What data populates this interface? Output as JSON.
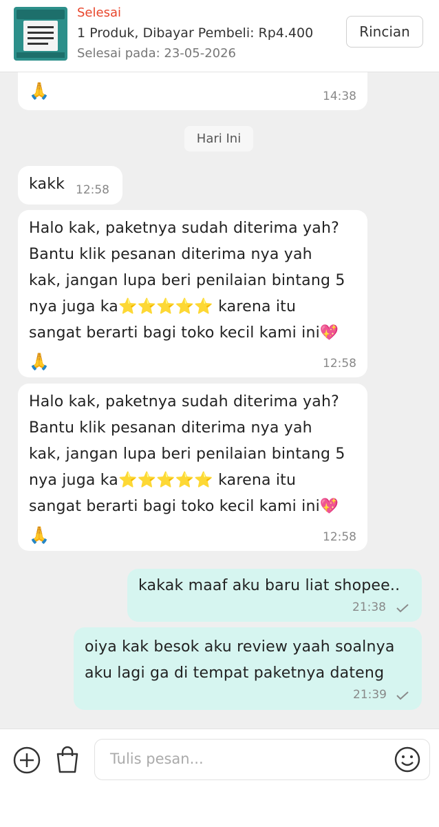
{
  "order": {
    "status": "Selesai",
    "summary": "1 Produk, Dibayar Pembeli: Rp4.400",
    "completed_at": "Selesai pada: 23-05-2026",
    "detail_button": "Rincian"
  },
  "messages": [
    {
      "from": "seller",
      "text": "🙏",
      "time": "14:38"
    },
    {
      "from": "seller",
      "text": "kakk",
      "time": "12:58"
    },
    {
      "from": "seller",
      "text": "Halo kak, paketnya sudah diterima yah?\nBantu klik pesanan diterima nya yah\nkak, jangan lupa beri penilaian bintang 5\nnya juga ka⭐⭐⭐⭐⭐ karena itu\nsangat berarti bagi toko kecil kami ini💖",
      "time": "12:58"
    },
    {
      "from": "seller",
      "text": "Halo kak, paketnya sudah diterima yah?\nBantu klik pesanan diterima nya yah\nkak, jangan lupa beri penilaian bintang 5\nnya juga ka⭐⭐⭐⭐⭐ karena itu\nsangat berarti bagi toko kecil kami ini💖",
      "time": "12:58"
    },
    {
      "from": "buyer",
      "text": "kakak maaf aku baru liat shopee..",
      "time": "21:38"
    },
    {
      "from": "buyer",
      "text": "oiya kak besok aku review yaah soalnya\naku lagi ga di tempat paketnya dateng",
      "time": "21:39"
    }
  ],
  "day_separator": "Hari Ini",
  "composer": {
    "placeholder": "Tulis pesan..."
  },
  "icons": [
    "plus-circle-icon",
    "shopping-bag-icon",
    "emoji-icon",
    "sent-check-icon"
  ],
  "colors": {
    "status": "#e8452b",
    "outgoing_bubble": "#d6f5f0",
    "incoming_bubble": "#ffffff",
    "background": "#efefef"
  }
}
